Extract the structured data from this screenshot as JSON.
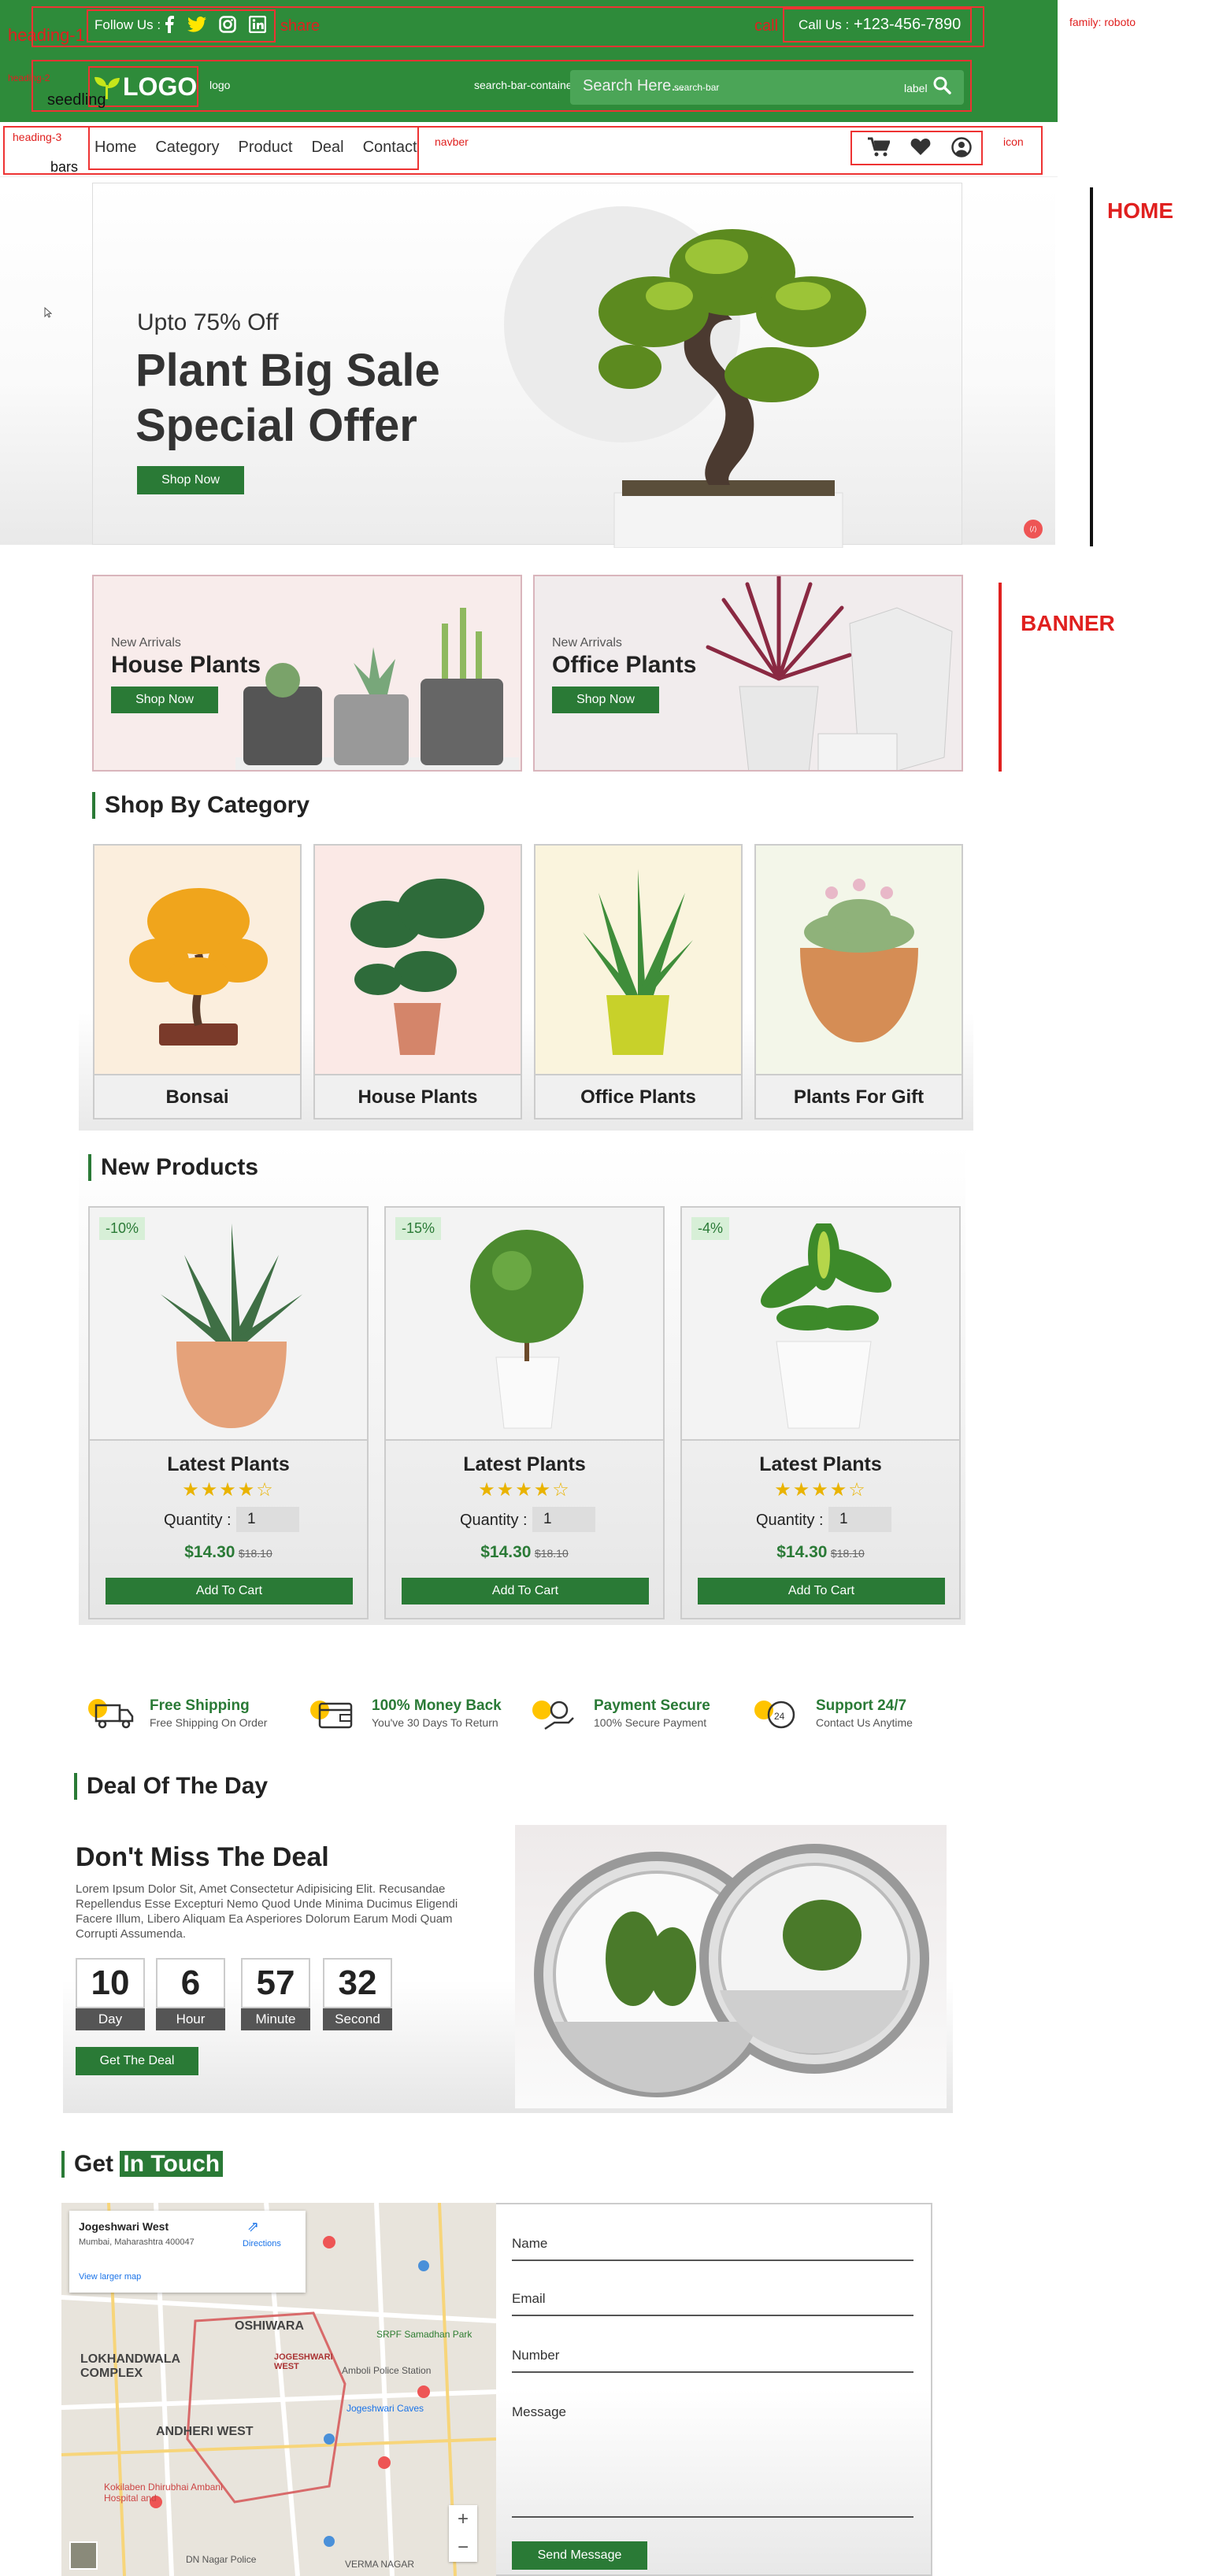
{
  "annotations": {
    "heading1": "heading-1",
    "heading2": "heading-2",
    "heading3": "heading-3",
    "share": "share",
    "call": "call",
    "family": "family: roboto",
    "seedling": "seedling",
    "logo_note": "logo",
    "search_container": "search-bar-container",
    "search_bar": "search-bar",
    "label": "label",
    "bars": "bars",
    "navber": "navber",
    "icon": "icon",
    "home": "HOME",
    "banner": "BANNER"
  },
  "topbar": {
    "follow": "Follow Us :",
    "call_label": "Call Us :",
    "phone": "+123-456-7890"
  },
  "header": {
    "logo": "LOGO",
    "search_placeholder": "Search Here..."
  },
  "nav": {
    "items": [
      "Home",
      "Category",
      "Product",
      "Deal",
      "Contact"
    ]
  },
  "hero": {
    "kicker": "Upto 75% Off",
    "title1": "Plant Big Sale",
    "title2": "Special Offer",
    "cta": "Shop Now"
  },
  "banners": [
    {
      "kicker": "New Arrivals",
      "title": "House Plants",
      "cta": "Shop Now"
    },
    {
      "kicker": "New Arrivals",
      "title": "Office Plants",
      "cta": "Shop Now"
    }
  ],
  "categories": {
    "title": "Shop By Category",
    "items": [
      "Bonsai",
      "House Plants",
      "Office Plants",
      "Plants For Gift"
    ]
  },
  "products": {
    "title": "New Products",
    "items": [
      {
        "discount": "-10%",
        "name": "Latest Plants",
        "qty_label": "Quantity :",
        "qty": "1",
        "price": "$14.30",
        "old": "$18.10",
        "cta": "Add To Cart"
      },
      {
        "discount": "-15%",
        "name": "Latest Plants",
        "qty_label": "Quantity :",
        "qty": "1",
        "price": "$14.30",
        "old": "$18.10",
        "cta": "Add To Cart"
      },
      {
        "discount": "-4%",
        "name": "Latest Plants",
        "qty_label": "Quantity :",
        "qty": "1",
        "price": "$14.30",
        "old": "$18.10",
        "cta": "Add To Cart"
      }
    ]
  },
  "features": [
    {
      "title": "Free Shipping",
      "sub": "Free Shipping On Order"
    },
    {
      "title": "100% Money Back",
      "sub": "You've 30 Days To Return"
    },
    {
      "title": "Payment Secure",
      "sub": "100% Secure Payment"
    },
    {
      "title": "Support 24/7",
      "sub": "Contact Us Anytime"
    }
  ],
  "deal": {
    "title": "Deal Of The Day",
    "heading": "Don't Miss The Deal",
    "body": "Lorem Ipsum Dolor Sit, Amet Consectetur Adipisicing Elit. Recusandae Repellendus Esse Excepturi Nemo Quod Unde Minima Ducimus Eligendi Facere Illum, Libero Aliquam Ea Asperiores Dolorum Earum Modi Quam Corrupti Assumenda.",
    "countdown": [
      {
        "n": "10",
        "u": "Day"
      },
      {
        "n": "6",
        "u": "Hour"
      },
      {
        "n": "57",
        "u": "Minute"
      },
      {
        "n": "32",
        "u": "Second"
      }
    ],
    "cta": "Get The Deal"
  },
  "contact": {
    "title_a": "Get",
    "title_b": "In Touch",
    "map": {
      "place": "Jogeshwari West",
      "addr": "Mumbai, Maharashtra 400047",
      "directions": "Directions",
      "larger": "View larger map",
      "labels": [
        "OSHIWARA",
        "LOKHANDWALA COMPLEX",
        "JOGESHWARI WEST",
        "ANDHERI WEST",
        "SRPF Samadhan Park",
        "Amboli Police Station",
        "Kokilaben Dhirubhai Ambani Hospital and",
        "VERMA NAGAR",
        "DN Nagar Police",
        "Jogeshwari Caves"
      ]
    },
    "fields": [
      "Name",
      "Email",
      "Number",
      "Message"
    ],
    "cta": "Send Message"
  }
}
